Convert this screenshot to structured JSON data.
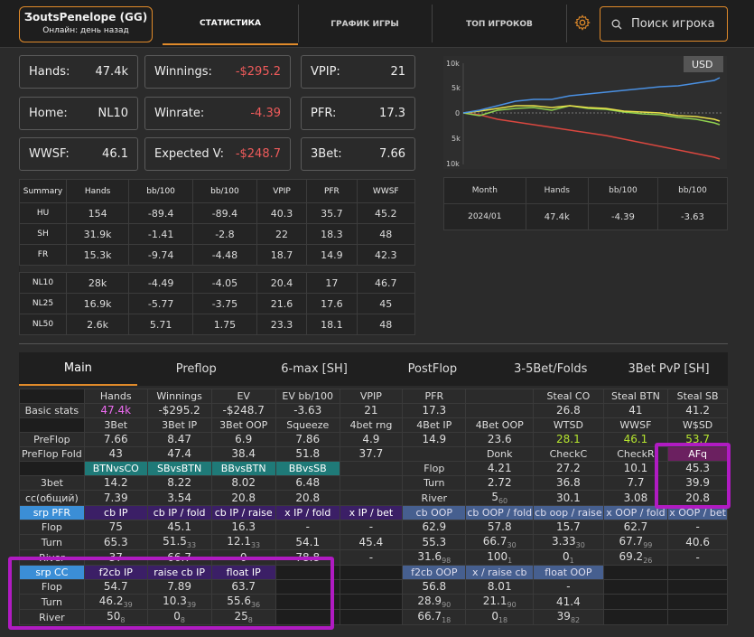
{
  "header": {
    "player_name": "ƷoutsPenelope (GG)",
    "player_status": "Онлайн: день назад",
    "nav": [
      "СТАТИСТИКА",
      "ГРАФИК ИГРЫ",
      "ТОП ИГРОКОВ"
    ],
    "search_label": "Поиск игрока"
  },
  "cards": [
    {
      "label": "Hands:",
      "value": "47.4k"
    },
    {
      "label": "Winnings:",
      "value": "-$295.2"
    },
    {
      "label": "VPIP:",
      "value": "21"
    },
    {
      "label": "Home:",
      "value": "NL10"
    },
    {
      "label": "Winrate:",
      "value": "-4.39"
    },
    {
      "label": "PFR:",
      "value": "17.3"
    },
    {
      "label": "WWSF:",
      "value": "46.1"
    },
    {
      "label": "Expected V:",
      "value": "-$248.7"
    },
    {
      "label": "3Bet:",
      "value": "7.66"
    }
  ],
  "summary": {
    "headers": [
      "Summary",
      "Hands",
      "bb/100",
      "bb/100",
      "VPIP",
      "PFR",
      "WWSF"
    ],
    "rows": [
      [
        "HU",
        "154",
        "-89.4",
        "-89.4",
        "40.3",
        "35.7",
        "45.2"
      ],
      [
        "SH",
        "31.9k",
        "-1.41",
        "-2.8",
        "22",
        "18.3",
        "48"
      ],
      [
        "FR",
        "15.3k",
        "-9.74",
        "-4.48",
        "18.7",
        "14.9",
        "42.3"
      ],
      [
        "NL10",
        "28k",
        "-4.49",
        "-4.05",
        "20.4",
        "17",
        "46.7"
      ],
      [
        "NL25",
        "16.9k",
        "-5.77",
        "-3.75",
        "21.6",
        "17.6",
        "45"
      ],
      [
        "NL50",
        "2.6k",
        "5.71",
        "1.75",
        "23.3",
        "18.1",
        "48"
      ]
    ]
  },
  "month_table": {
    "headers": [
      "Month",
      "Hands",
      "bb/100",
      "bb/100"
    ],
    "row": [
      "2024/01",
      "47.4k",
      "-4.39",
      "-3.63"
    ]
  },
  "chart": {
    "currency": "USD",
    "y_ticks": [
      "10k",
      "5k",
      "0",
      "5k",
      "10k"
    ],
    "colors": {
      "blue": "#4a90e2",
      "green": "#8fd14f",
      "yellow": "#e8e04a",
      "red": "#d9473f"
    }
  },
  "tabs": [
    "Main",
    "Preflop",
    "6-max [SH]",
    "PostFlop",
    "3-5Bet/Folds",
    "3Bet PvP [SH]"
  ],
  "grid": {
    "r1": [
      "",
      "Hands",
      "Winnings",
      "EV",
      "EV bb/100",
      "VPIP",
      "PFR",
      "",
      "Steal CO",
      "Steal BTN",
      "Steal SB"
    ],
    "r2": [
      "Basic stats",
      "47.4k",
      "-$295.2",
      "-$248.7",
      "-3.63",
      "21",
      "17.3",
      "",
      "26.8",
      "41",
      "41.2"
    ],
    "r3": [
      "",
      "3Bet",
      "3Bet IP",
      "3Bet OOP",
      "Squeeze",
      "4bet rng",
      "4Bet IP",
      "4Bet OOP",
      "WTSD",
      "WWSF",
      "W$SD"
    ],
    "r4": [
      "PreFlop",
      "7.66",
      "8.47",
      "6.9",
      "7.86",
      "4.9",
      "14.9",
      "23.6",
      "28.1",
      "46.1",
      "53.7"
    ],
    "r5": [
      "PreFlop Fold",
      "43",
      "47.4",
      "38.4",
      "51.8",
      "37.7",
      "",
      "Donk",
      "CheckC",
      "CheckR",
      "AFq"
    ],
    "r6": [
      "",
      "BTNvsCO",
      "SBvsBTN",
      "BBvsBTN",
      "BBvsSB",
      "",
      "Flop",
      "4.21",
      "27.2",
      "10.1",
      "45.3"
    ],
    "r7": [
      "3bet",
      "14.2",
      "8.22",
      "8.02",
      "6.48",
      "",
      "Turn",
      "2.72",
      "36.8",
      "7.7",
      "39.9"
    ],
    "r8": [
      "cc(общий)",
      "7.39",
      "3.54",
      "20.8",
      "20.8",
      "",
      "River",
      "5",
      "60",
      "30.1",
      "3.08",
      "20.8"
    ],
    "r9": [
      "srp PFR",
      "cb IP",
      "cb IP / fold",
      "cb IP / raise",
      "x IP / fold",
      "x IP / bet",
      "cb OOP",
      "cb OOP / fold",
      "cb oop / raise",
      "x OOP / fold",
      "x OOP / bet"
    ],
    "r10": [
      "Flop",
      "75",
      "45.1",
      "16.3",
      "-",
      "-",
      "62.9",
      "57.8",
      "15.7",
      "62.7",
      "-"
    ],
    "r11": [
      "Turn",
      "65.3",
      "51.5",
      "33",
      "12.1",
      "33",
      "54.1",
      "45.4",
      "55.3",
      "66.7",
      "30",
      "3.33",
      "30",
      "67.7",
      "99",
      "40.6"
    ],
    "r12": [
      "River",
      "37",
      "66.7",
      "0",
      "78.8",
      "-",
      "31.6",
      "98",
      "100",
      "1",
      "0",
      "1",
      "69.2",
      "26",
      "-"
    ],
    "r13": [
      "srp CC",
      "f2cb IP",
      "raise cb IP",
      "float IP",
      "",
      "",
      "f2cb OOP",
      "x / raise cb",
      "float OOP"
    ],
    "r14": [
      "Flop",
      "54.7",
      "7.89",
      "63.7",
      "56.8",
      "8.01",
      "-"
    ],
    "r15": [
      "Turn",
      "46.2",
      "39",
      "10.3",
      "39",
      "55.6",
      "36",
      "28.9",
      "90",
      "21.1",
      "90",
      "41.4"
    ],
    "r16": [
      "River",
      "50",
      "8",
      "0",
      "8",
      "25",
      "8",
      "66.7",
      "18",
      "0",
      "18",
      "39",
      "82"
    ]
  }
}
